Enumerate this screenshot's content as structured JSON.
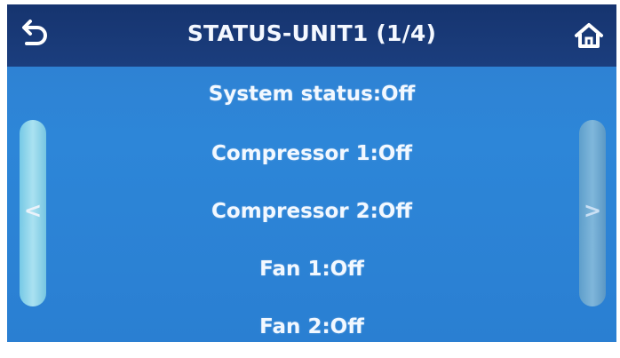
{
  "header": {
    "title": "STATUS-UNIT1 (1/4)",
    "back_icon": "back-arrow-icon",
    "home_icon": "home-icon"
  },
  "status_items": [
    {
      "label": "System status:Off"
    },
    {
      "label": "Compressor 1:Off"
    },
    {
      "label": "Compressor 2:Off"
    },
    {
      "label": "Fan 1:Off"
    },
    {
      "label": "Fan 2:Off"
    }
  ],
  "nav": {
    "prev_symbol": "<",
    "next_symbol": ">"
  },
  "colors": {
    "header_bg": "#1b3e7e",
    "screen_bg": "#2d86d8",
    "text": "#f2f8ff",
    "side_button_left": "#9fe0ee",
    "side_button_right": "#8ebdd6"
  }
}
